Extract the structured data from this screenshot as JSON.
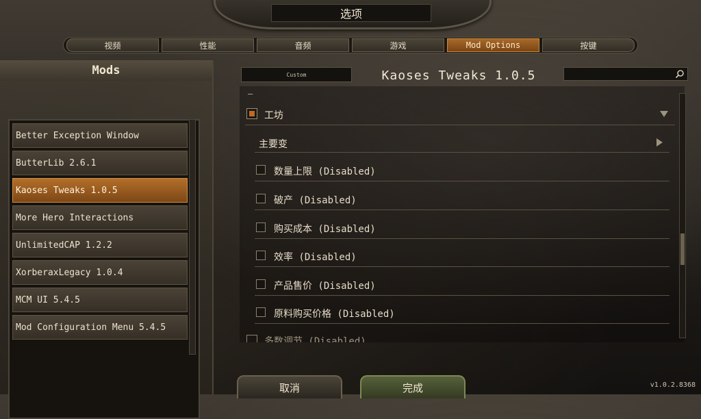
{
  "window": {
    "title": "选项"
  },
  "tabs": [
    {
      "label": "视频",
      "active": false
    },
    {
      "label": "性能",
      "active": false
    },
    {
      "label": "音频",
      "active": false
    },
    {
      "label": "游戏",
      "active": false
    },
    {
      "label": "Mod Options",
      "active": true
    },
    {
      "label": "按键",
      "active": false
    }
  ],
  "sidebar": {
    "header": "Mods",
    "items": [
      {
        "label": "Better Exception Window",
        "selected": false
      },
      {
        "label": "ButterLib 2.6.1",
        "selected": false
      },
      {
        "label": "Kaoses Tweaks 1.0.5",
        "selected": true
      },
      {
        "label": "More Hero Interactions",
        "selected": false
      },
      {
        "label": "UnlimitedCAP 1.2.2",
        "selected": false
      },
      {
        "label": "XorberaxLegacy 1.0.4",
        "selected": false
      },
      {
        "label": "MCM UI 5.4.5",
        "selected": false
      },
      {
        "label": "Mod Configuration Menu 5.4.5",
        "selected": false
      }
    ]
  },
  "main": {
    "preset_label": "Custom",
    "title": "Kaoses Tweaks 1.0.5",
    "search": {
      "value": "",
      "icon": "search-icon"
    },
    "top_dash": "—",
    "group": {
      "label": "工坊",
      "checked": true,
      "expanded": true
    },
    "subgroup": {
      "label": "主要变",
      "expanded": false
    },
    "options": [
      {
        "label": "数量上限 (Disabled)",
        "checked": false
      },
      {
        "label": "破产 (Disabled)",
        "checked": false
      },
      {
        "label": "购买成本 (Disabled)",
        "checked": false
      },
      {
        "label": "效率 (Disabled)",
        "checked": false
      },
      {
        "label": "产品售价 (Disabled)",
        "checked": false
      },
      {
        "label": "原料购买价格 (Disabled)",
        "checked": false
      }
    ],
    "partial_row": "多数调节 (Disabled)"
  },
  "footer": {
    "cancel_label": "取消",
    "done_label": "完成",
    "version": "v1.0.2.8368"
  },
  "colors": {
    "accent": "#b36f2a",
    "done_button": "#56613a"
  }
}
